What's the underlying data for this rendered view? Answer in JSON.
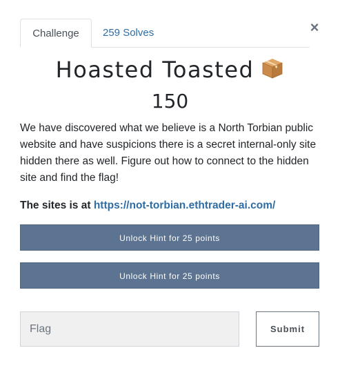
{
  "tabs": {
    "challenge_label": "Challenge",
    "solves_label": "259 Solves"
  },
  "close_label": "×",
  "challenge": {
    "title": "Hoasted Toasted",
    "title_icon": "package-box-icon",
    "points": "150",
    "description": "We have discovered what we believe is a North Torbian public website and have suspicions there is a secret internal-only site hidden there as well. Figure out how to connect to the hidden site and find the flag!",
    "sites_prefix": "The sites is at ",
    "sites_url": "https://not-torbian.ethtrader-ai.com/"
  },
  "hints": [
    {
      "label": "Unlock Hint for 25 points"
    },
    {
      "label": "Unlock Hint for 25 points"
    }
  ],
  "flag_form": {
    "placeholder": "Flag",
    "value": "",
    "submit_label": "Submit"
  },
  "colors": {
    "hint_button_bg": "#5c7391",
    "link": "#2e6da4"
  }
}
